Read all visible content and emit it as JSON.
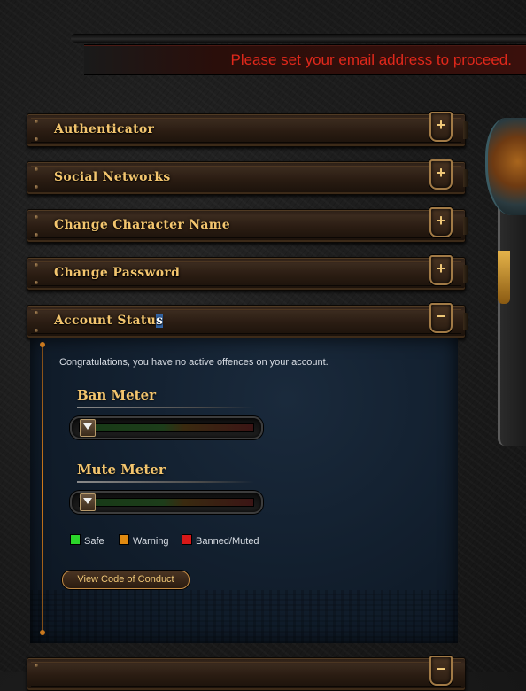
{
  "notice": {
    "text": "Please set your email address to proceed."
  },
  "accordion": {
    "items": [
      {
        "label": "Authenticator",
        "toggle": "+"
      },
      {
        "label": "Social Networks",
        "toggle": "+"
      },
      {
        "label": "Change Character Name",
        "toggle": "+"
      },
      {
        "label": "Change Password",
        "toggle": "+"
      },
      {
        "label_main": "Account Statu",
        "label_caret": "s",
        "toggle": "−"
      }
    ],
    "next_toggle": "−"
  },
  "account_status": {
    "message": "Congratulations, you have no active offences on your account.",
    "ban_meter": {
      "title": "Ban Meter",
      "level": 0.0
    },
    "mute_meter": {
      "title": "Mute Meter",
      "level": 0.0
    },
    "legend": [
      {
        "label": "Safe",
        "color": "#2bd52b"
      },
      {
        "label": "Warning",
        "color": "#e08a10"
      },
      {
        "label": "Banned/Muted",
        "color": "#d81818"
      }
    ],
    "conduct_button": "View Code of Conduct"
  },
  "colors": {
    "accent_gold": "#f3c56e",
    "notice_red": "#e0281b",
    "panel_blue": "#121f2e"
  }
}
